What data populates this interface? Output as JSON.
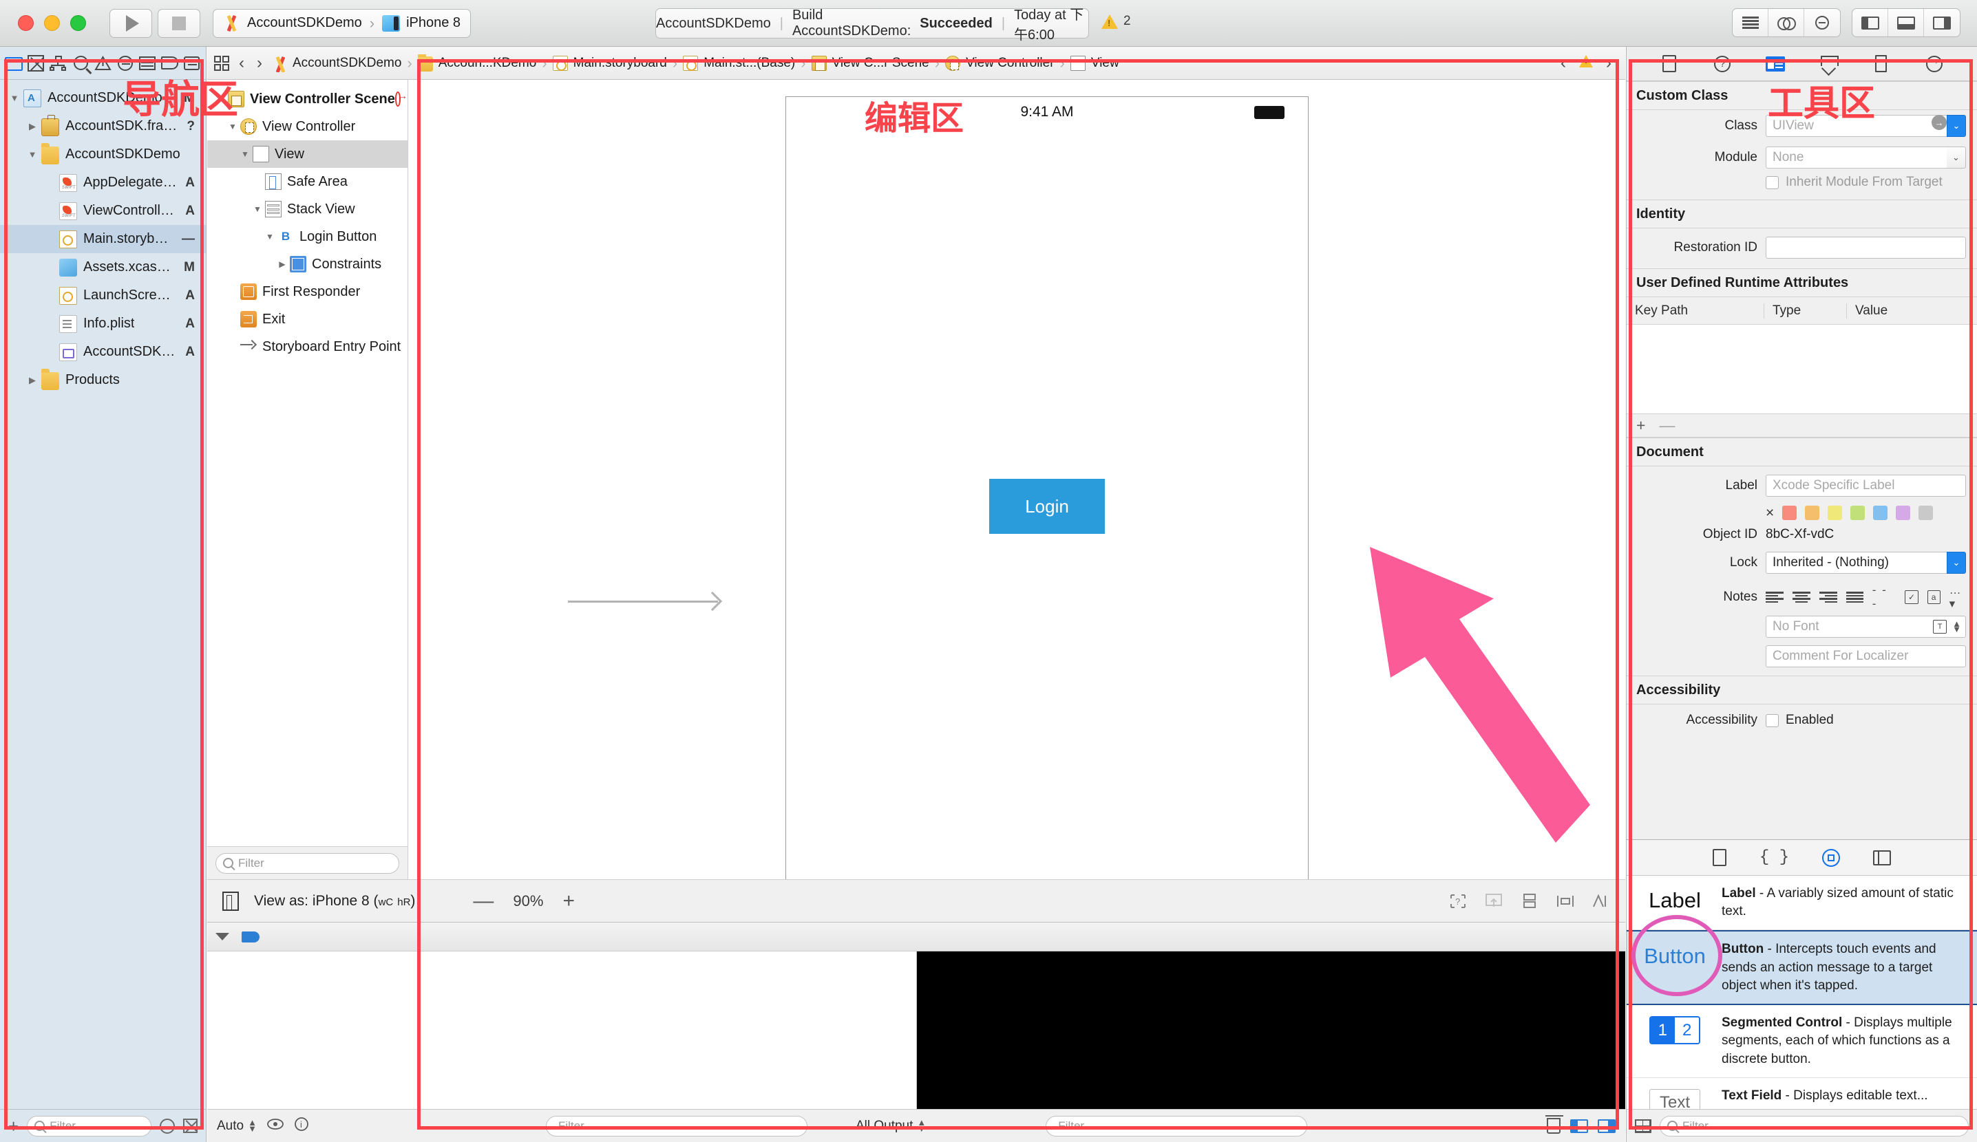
{
  "titlebar": {
    "scheme_project": "AccountSDKDemo",
    "scheme_device": "iPhone 8",
    "status_target": "AccountSDKDemo",
    "status_divider": "|",
    "status_action": "Build AccountSDKDemo:",
    "status_result": "Succeeded",
    "status_divider2": "|",
    "status_time": "Today at 下午6:00",
    "warning_count": "2"
  },
  "navigator": {
    "tabs": [
      {
        "name": "project-navigator",
        "icon": "folder-icon",
        "active": true
      },
      {
        "name": "source-control-navigator",
        "icon": "source-control-icon",
        "active": false
      },
      {
        "name": "symbol-navigator",
        "icon": "hierarchy-icon",
        "active": false
      },
      {
        "name": "find-navigator",
        "icon": "search-icon",
        "active": false
      },
      {
        "name": "issue-navigator",
        "icon": "warning-triangle-icon",
        "active": false
      },
      {
        "name": "test-navigator",
        "icon": "diamond-icon",
        "active": false
      },
      {
        "name": "debug-navigator",
        "icon": "grid-icon",
        "active": false
      },
      {
        "name": "breakpoint-navigator",
        "icon": "tag-icon",
        "active": false
      },
      {
        "name": "report-navigator",
        "icon": "message-icon",
        "active": false
      }
    ],
    "files": [
      {
        "name": "AccountSDKDemo",
        "icon": "xcode-project-icon",
        "indent": 0,
        "disclosure": "down",
        "badge": "M",
        "selected": false
      },
      {
        "name": "AccountSDK.framework",
        "icon": "framework-icon",
        "indent": 1,
        "disclosure": "right",
        "badge": "?",
        "selected": false
      },
      {
        "name": "AccountSDKDemo",
        "icon": "folder-icon",
        "indent": 1,
        "disclosure": "down",
        "badge": "",
        "selected": false
      },
      {
        "name": "AppDelegate.swift",
        "icon": "swift-file-icon",
        "indent": 2,
        "disclosure": "",
        "badge": "A",
        "selected": false
      },
      {
        "name": "ViewController.swift",
        "icon": "swift-file-icon",
        "indent": 2,
        "disclosure": "",
        "badge": "A",
        "selected": false
      },
      {
        "name": "Main.storyboard",
        "icon": "storyboard-icon",
        "indent": 2,
        "disclosure": "",
        "badge": "—",
        "selected": true
      },
      {
        "name": "Assets.xcassets",
        "icon": "assets-icon",
        "indent": 2,
        "disclosure": "",
        "badge": "M",
        "selected": false
      },
      {
        "name": "LaunchScreen.storyboard",
        "icon": "storyboard-icon",
        "indent": 2,
        "disclosure": "",
        "badge": "A",
        "selected": false
      },
      {
        "name": "Info.plist",
        "icon": "plist-icon",
        "indent": 2,
        "disclosure": "",
        "badge": "A",
        "selected": false
      },
      {
        "name": "AccountSDKDemo.xcdatamodeld",
        "icon": "datamodel-icon",
        "indent": 2,
        "disclosure": "",
        "badge": "A",
        "selected": false
      },
      {
        "name": "Products",
        "icon": "folder-icon",
        "indent": 1,
        "disclosure": "right",
        "badge": "",
        "selected": false
      }
    ],
    "footer": {
      "add_label": "+",
      "filter_placeholder": "Filter"
    },
    "annotation": "导航区"
  },
  "editor": {
    "breadcrumb": [
      {
        "label": "AccountSDKDemo",
        "icon": "xcode-project-icon"
      },
      {
        "label": "Accoun...KDemo",
        "icon": "folder-icon"
      },
      {
        "label": "Main.storyboard",
        "icon": "storyboard-icon"
      },
      {
        "label": "Main.st...(Base)",
        "icon": "storyboard-icon"
      },
      {
        "label": "View C...r Scene",
        "icon": "scene-icon"
      },
      {
        "label": "View Controller",
        "icon": "view-controller-icon"
      },
      {
        "label": "View",
        "icon": "view-icon"
      }
    ],
    "jumpbar_warning_count": "",
    "outline": [
      {
        "label": "View Controller Scene",
        "icon": "scene-icon",
        "indent": 0,
        "disclosure": "down",
        "bold": true,
        "selected": false,
        "trailing": "entry-point-dot"
      },
      {
        "label": "View Controller",
        "icon": "view-controller-icon",
        "indent": 1,
        "disclosure": "down",
        "bold": false,
        "selected": false,
        "trailing": ""
      },
      {
        "label": "View",
        "icon": "view-icon",
        "indent": 2,
        "disclosure": "down",
        "bold": false,
        "selected": true,
        "trailing": ""
      },
      {
        "label": "Safe Area",
        "icon": "safe-area-icon",
        "indent": 3,
        "disclosure": "",
        "bold": false,
        "selected": false,
        "trailing": ""
      },
      {
        "label": "Stack View",
        "icon": "stack-view-icon",
        "indent": 3,
        "disclosure": "down",
        "bold": false,
        "selected": false,
        "trailing": ""
      },
      {
        "label": "Login Button",
        "icon": "button-icon",
        "indent": 4,
        "disclosure": "down",
        "bold": false,
        "selected": false,
        "trailing": ""
      },
      {
        "label": "Constraints",
        "icon": "constraints-icon",
        "indent": 5,
        "disclosure": "right",
        "bold": false,
        "selected": false,
        "trailing": ""
      },
      {
        "label": "First Responder",
        "icon": "first-responder-icon",
        "indent": 1,
        "disclosure": "",
        "bold": false,
        "selected": false,
        "trailing": ""
      },
      {
        "label": "Exit",
        "icon": "exit-icon",
        "indent": 1,
        "disclosure": "",
        "bold": false,
        "selected": false,
        "trailing": ""
      },
      {
        "label": "Storyboard Entry Point",
        "icon": "entry-point-icon",
        "indent": 1,
        "disclosure": "",
        "bold": false,
        "selected": false,
        "trailing": ""
      }
    ],
    "outline_filter_placeholder": "Filter",
    "canvas": {
      "device_clock": "9:41 AM",
      "login_button_label": "Login"
    },
    "canvas_footer": {
      "view_as_label": "View as: iPhone 8 (",
      "view_as_wc": "wC",
      "view_as_hr": "hR",
      "view_as_close": ")",
      "zoom_minus": "—",
      "zoom_value": "90%",
      "zoom_plus": "+"
    },
    "annotation": "编辑区"
  },
  "debug": {
    "footer_auto": "Auto",
    "variables_filter_placeholder": "Filter",
    "output_scope": "All Output",
    "console_filter_placeholder": "Filter"
  },
  "inspector": {
    "tabs": [
      {
        "name": "file-inspector",
        "icon": "document-icon",
        "active": false
      },
      {
        "name": "quick-help-inspector",
        "icon": "question-mark-icon",
        "active": false
      },
      {
        "name": "identity-inspector",
        "icon": "identity-card-icon",
        "active": true
      },
      {
        "name": "attributes-inspector",
        "icon": "attributes-icon",
        "active": false
      },
      {
        "name": "size-inspector",
        "icon": "ruler-icon",
        "active": false
      },
      {
        "name": "connections-inspector",
        "icon": "arrow-circle-icon",
        "active": false
      }
    ],
    "custom_class": {
      "section_title": "Custom Class",
      "class_label": "Class",
      "class_value": "UIView",
      "module_label": "Module",
      "module_value": "None",
      "inherit_label": "Inherit Module From Target"
    },
    "identity": {
      "section_title": "Identity",
      "restoration_label": "Restoration ID",
      "restoration_value": ""
    },
    "runtime_attributes": {
      "section_title": "User Defined Runtime Attributes",
      "col_key": "Key Path",
      "col_type": "Type",
      "col_value": "Value",
      "add_label": "+",
      "remove_label": "—"
    },
    "document": {
      "section_title": "Document",
      "label_label": "Label",
      "label_placeholder": "Xcode Specific Label",
      "swatch_clear": "×",
      "swatches": [
        "#f98b7e",
        "#f5be6d",
        "#f0e97a",
        "#c2e07a",
        "#84c0ef",
        "#d5a9e8",
        "#c9c9c9"
      ],
      "objectid_label": "Object ID",
      "objectid_value": "8bC-Xf-vdC",
      "lock_label": "Lock",
      "lock_value": "Inherited - (Nothing)",
      "notes_label": "Notes",
      "font_placeholder": "No Font",
      "comment_placeholder": "Comment For Localizer"
    },
    "accessibility": {
      "section_title": "Accessibility",
      "accessibility_label": "Accessibility",
      "enabled_label": "Enabled"
    },
    "annotation": "工具区"
  },
  "library": {
    "tabs": [
      {
        "name": "file-template-library",
        "icon": "document-icon",
        "active": false
      },
      {
        "name": "code-snippet-library",
        "icon": "braces-icon",
        "active": false
      },
      {
        "name": "object-library",
        "icon": "object-circle-icon",
        "active": true
      },
      {
        "name": "media-library",
        "icon": "media-icon",
        "active": false
      }
    ],
    "items": [
      {
        "thumb": "Label",
        "thumb_kind": "label",
        "name": "Label",
        "desc": " - A variably sized amount of static text.",
        "selected": false
      },
      {
        "thumb": "Button",
        "thumb_kind": "button",
        "name": "Button",
        "desc": " - Intercepts touch events and sends an action message to a target object when it's tapped.",
        "selected": true
      },
      {
        "thumb": "1 2",
        "thumb_kind": "segmented",
        "name": "Segmented Control",
        "desc": " - Displays multiple segments, each of which functions as a discrete button.",
        "selected": false
      },
      {
        "thumb": "Text",
        "thumb_kind": "textfield",
        "name": "Text Field",
        "desc": " - Displays editable text...",
        "selected": false
      }
    ],
    "filter_placeholder": "Filter"
  },
  "colors": {
    "annotation_red": "#f8434b",
    "annotation_pink": "#e05ab8",
    "selection_blue": "#c2d4e6",
    "accent_blue": "#1572e8",
    "login_button_blue": "#2a9bdb"
  }
}
